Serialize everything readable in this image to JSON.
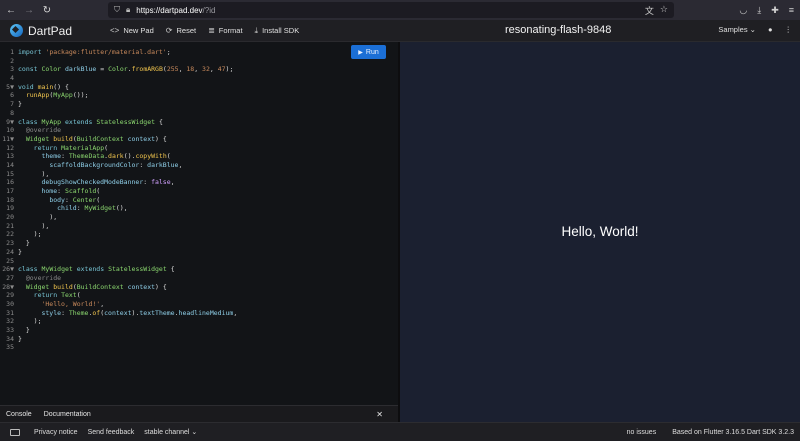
{
  "browser": {
    "url_host": "https://dartpad.dev",
    "url_path": "/?id",
    "back_icon": "arrow-left-icon",
    "forward_icon": "arrow-right-icon",
    "reload_icon": "reload-icon"
  },
  "header": {
    "app_name": "DartPad",
    "new_pad": "New Pad",
    "reset": "Reset",
    "format": "Format",
    "install_sdk": "Install SDK",
    "pad_title": "resonating-flash-9848",
    "samples": "Samples"
  },
  "editor": {
    "run_label": "Run",
    "line_numbers": [
      "1",
      "2",
      "3",
      "4",
      "5",
      "6",
      "7",
      "8",
      "9",
      "10",
      "11",
      "12",
      "13",
      "14",
      "15",
      "16",
      "17",
      "18",
      "19",
      "20",
      "21",
      "22",
      "23",
      "24",
      "25",
      "26",
      "27",
      "28",
      "29",
      "30",
      "31",
      "32",
      "33",
      "34",
      "35"
    ],
    "fold_markers": {
      "5": "▼",
      "9": "▼",
      "11": "▼",
      "26": "▼",
      "28": "▼"
    }
  },
  "preview": {
    "text": "Hello, World!"
  },
  "console": {
    "console_tab": "Console",
    "documentation_tab": "Documentation",
    "close": "✕"
  },
  "footer": {
    "privacy": "Privacy notice",
    "feedback": "Send feedback",
    "channel": "stable channel",
    "issues": "no issues",
    "based_on": "Based on Flutter 3.16.5 Dart SDK 3.2.3"
  },
  "colors": {
    "run_button": "#1b6fd6",
    "preview_bg": "#1b2030",
    "editor_bg": "#121417"
  }
}
